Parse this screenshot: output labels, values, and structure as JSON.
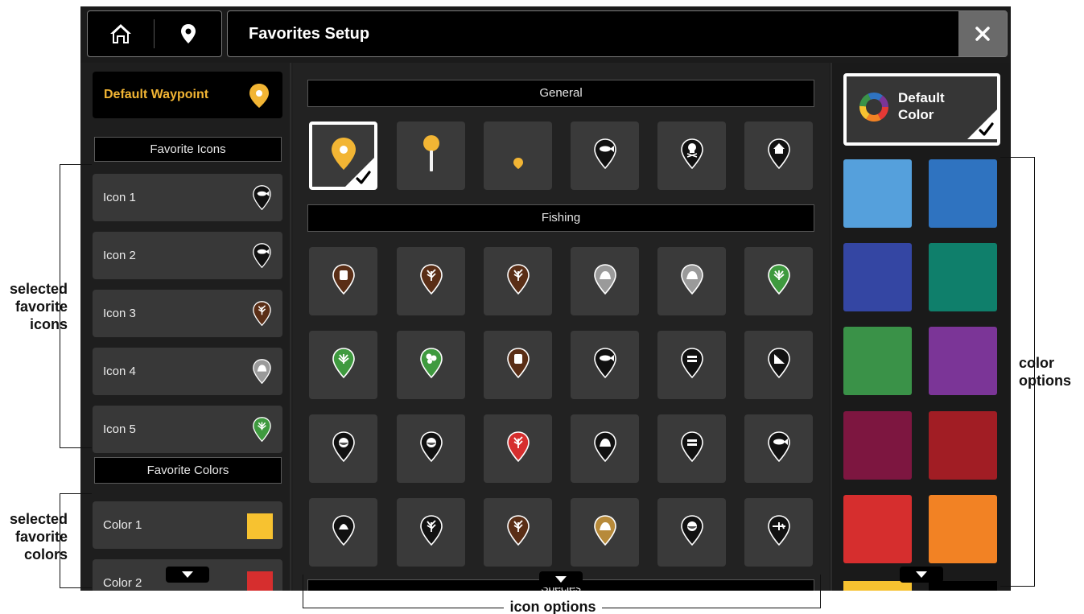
{
  "topbar": {
    "title": "Favorites Setup",
    "home_icon": "home-icon",
    "pin_icon": "waypoint-pin-icon",
    "close_icon": "close-icon"
  },
  "left": {
    "default_waypoint": "Default Waypoint",
    "favorite_icons_header": "Favorite Icons",
    "icons": [
      {
        "label": "Icon 1",
        "icon": "fish-marker-icon",
        "color": "#111111"
      },
      {
        "label": "Icon 2",
        "icon": "school-fish-marker-icon",
        "color": "#111111"
      },
      {
        "label": "Icon 3",
        "icon": "timber-marker-icon",
        "color": "#5a2e16"
      },
      {
        "label": "Icon 4",
        "icon": "rock-marker-icon",
        "color": "#9a9a9a"
      },
      {
        "label": "Icon 5",
        "icon": "weed-marker-icon",
        "color": "#3f9a3f"
      }
    ],
    "favorite_colors_header": "Favorite Colors",
    "colors": [
      {
        "label": "Color 1",
        "swatch": "#f7c230"
      },
      {
        "label": "Color 2",
        "swatch": "#d62e2e"
      }
    ]
  },
  "middle": {
    "general_header": "General",
    "general_icons": [
      {
        "icon": "default-waypoint-icon",
        "color": "#f2b534",
        "selected": true
      },
      {
        "icon": "push-pin-icon",
        "color": "#f2b534",
        "selected": false
      },
      {
        "icon": "small-dot-icon",
        "color": "#f2b534",
        "selected": false
      },
      {
        "icon": "fish-marker-icon",
        "color": "#111111",
        "selected": false
      },
      {
        "icon": "skull-marker-icon",
        "color": "#111111",
        "selected": false
      },
      {
        "icon": "house-marker-icon",
        "color": "#111111",
        "selected": false
      }
    ],
    "fishing_header": "Fishing",
    "fishing_icons": [
      [
        {
          "icon": "stump-marker-icon",
          "color": "#5a2e16"
        },
        {
          "icon": "brush-marker-icon",
          "color": "#5a2e16"
        },
        {
          "icon": "timber-marker-icon",
          "color": "#5a2e16"
        },
        {
          "icon": "rock-marker-icon",
          "color": "#9a9a9a"
        },
        {
          "icon": "rock-pile-marker-icon",
          "color": "#9a9a9a"
        },
        {
          "icon": "weed-marker-icon",
          "color": "#3f9a3f"
        }
      ],
      [
        {
          "icon": "plant-marker-icon",
          "color": "#3f9a3f"
        },
        {
          "icon": "lily-pad-marker-icon",
          "color": "#3f9a3f"
        },
        {
          "icon": "dock-marker-icon",
          "color": "#5a2e16"
        },
        {
          "icon": "school-fish-marker-icon",
          "color": "#111111"
        },
        {
          "icon": "bait-ball-marker-icon",
          "color": "#111111"
        },
        {
          "icon": "drop-off-marker-icon",
          "color": "#111111"
        }
      ],
      [
        {
          "icon": "hump-marker-icon",
          "color": "#111111"
        },
        {
          "icon": "hole-marker-icon",
          "color": "#111111"
        },
        {
          "icon": "coral-marker-icon",
          "color": "#d62e2e"
        },
        {
          "icon": "rock-ledge-marker-icon",
          "color": "#111111"
        },
        {
          "icon": "bed-marker-icon",
          "color": "#111111"
        },
        {
          "icon": "fish-jump-marker-icon",
          "color": "#111111"
        }
      ],
      [
        {
          "icon": "shell-marker-icon",
          "color": "#111111"
        },
        {
          "icon": "sponge-marker-icon",
          "color": "#111111"
        },
        {
          "icon": "reef-marker-icon",
          "color": "#5a2e16"
        },
        {
          "icon": "sand-marker-icon",
          "color": "#b78a3a"
        },
        {
          "icon": "buoy-marker-icon",
          "color": "#111111"
        },
        {
          "icon": "airplane-marker-icon",
          "color": "#111111"
        }
      ]
    ],
    "next_header": "Species"
  },
  "right": {
    "default_color_line1": "Default",
    "default_color_line2": "Color",
    "default_color_icon": "color-wheel-icon",
    "colors": [
      [
        "#55a0dc",
        "#2f73c0"
      ],
      [
        "#3446a3",
        "#0f7f6b"
      ],
      [
        "#3a9248",
        "#7b3597"
      ],
      [
        "#7d1640",
        "#a11d24"
      ],
      [
        "#d62e2e",
        "#f28224"
      ]
    ]
  },
  "annotations": {
    "selected_icons": [
      "selected",
      "favorite",
      "icons"
    ],
    "selected_colors": [
      "selected",
      "favorite",
      "colors"
    ],
    "color_options": [
      "color",
      "options"
    ],
    "icon_options": "icon options"
  }
}
